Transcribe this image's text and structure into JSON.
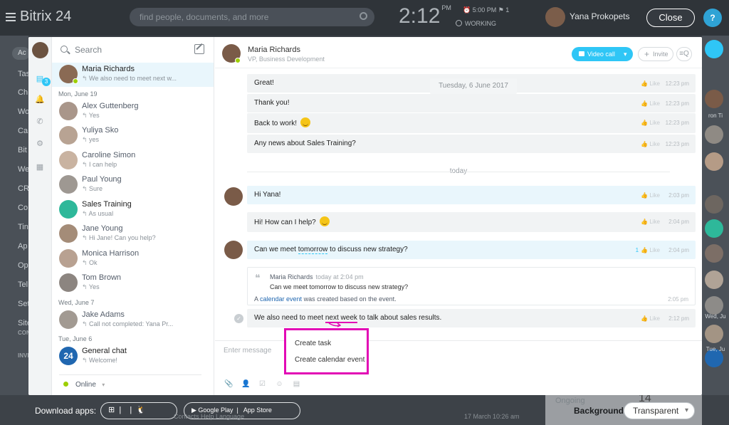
{
  "portal": {
    "logo": "Bitrix 24",
    "search_placeholder": "find people, documents, and more",
    "clock": "2:12",
    "clock_ampm": "PM",
    "clock_meta": "⏰ 5:00 PM   ⚑ 1",
    "work_status": "WORKING",
    "user_name": "Yana Prokopets",
    "close_label": "Close",
    "help_label": "?",
    "acc_label": "Ac",
    "left_menu": [
      "Tas",
      "Ch",
      "Wo",
      "Ca",
      "Bit",
      "We",
      "CR",
      "Co",
      "Tin",
      "Ap",
      "Op",
      "Tel",
      "Set",
      "Sites"
    ],
    "left_small": [
      "CONFI",
      "INVITE"
    ],
    "right_names": [
      "ron Ti",
      "Wed, Ju",
      "Tue, Ju"
    ],
    "bottom": {
      "download_label": "Download apps:",
      "google_play": "Google Play",
      "app_store": "App Store",
      "footer_left": "Contacts    Help    Language",
      "footer_date": "17 March 10:26 am",
      "background_label": "Background:",
      "background_value": "Transparent",
      "ongoing_label": "Ongoing",
      "ongoing_count": "14"
    }
  },
  "messenger": {
    "search_label": "Search",
    "rail_badge": "3",
    "status_label": "Online",
    "chats": [
      {
        "name": "Maria Richards",
        "preview": "We also need to meet next w...",
        "active": true
      },
      {
        "date": "Mon, June 19"
      },
      {
        "name": "Alex Guttenberg",
        "preview": "Yes"
      },
      {
        "name": "Yuliya Sko",
        "preview": "yes"
      },
      {
        "name": "Caroline Simon",
        "preview": "I can help"
      },
      {
        "name": "Paul Young",
        "preview": "Sure"
      },
      {
        "name": "Sales Training",
        "preview": "As usual"
      },
      {
        "name": "Jane Young",
        "preview": "Hi Jane! Can you help?"
      },
      {
        "name": "Monica Harrison",
        "preview": "Ok"
      },
      {
        "name": "Tom Brown",
        "preview": "Yes"
      },
      {
        "date": "Wed, June 7"
      },
      {
        "name": "Jake Adams",
        "preview": "Call not completed: Yana Pr..."
      },
      {
        "date": "Tue, June 6"
      },
      {
        "name": "General chat",
        "preview": "Welcome!"
      }
    ],
    "header": {
      "name": "Maria Richards",
      "position": "VP, Business Development",
      "video_call": "Video call",
      "invite": "Invite",
      "search_icon": "≡Q"
    },
    "date_pill": "Tuesday, 6 June 2017",
    "today_label": "today",
    "like_label": "Like",
    "messages": [
      {
        "text": "Great!",
        "time": "12:23 pm"
      },
      {
        "text": "Thank you!",
        "time": "12:23 pm"
      },
      {
        "text": "Back to work!",
        "time": "12:23 pm"
      },
      {
        "text": "Any news about Sales Training?",
        "time": "12:23 pm"
      },
      {
        "text": "Hi Yana!",
        "time": "2:03 pm"
      },
      {
        "text": "Hi! How can I help?",
        "time": "2:04 pm"
      },
      {
        "text_a": "Can we meet ",
        "text_b": "tomorrow",
        "text_c": " to discuss new strategy?",
        "likes": "1",
        "time": "2:04 pm"
      },
      {
        "text_a": "We also need to meet ",
        "text_b": "next week",
        "text_c": " to talk about sales results.",
        "time": "2:12 pm"
      }
    ],
    "quote": {
      "author": "Maria Richards",
      "time": "today at 2:04 pm",
      "text": "Can we meet tomorrow to discuss new strategy?",
      "sys_a": "A ",
      "sys_link": "calendar event",
      "sys_b": " was created based on the event.",
      "sys_time": "2:05 pm"
    },
    "input_placeholder": "Enter message",
    "context_menu": [
      "Create task",
      "Create calendar event"
    ]
  }
}
